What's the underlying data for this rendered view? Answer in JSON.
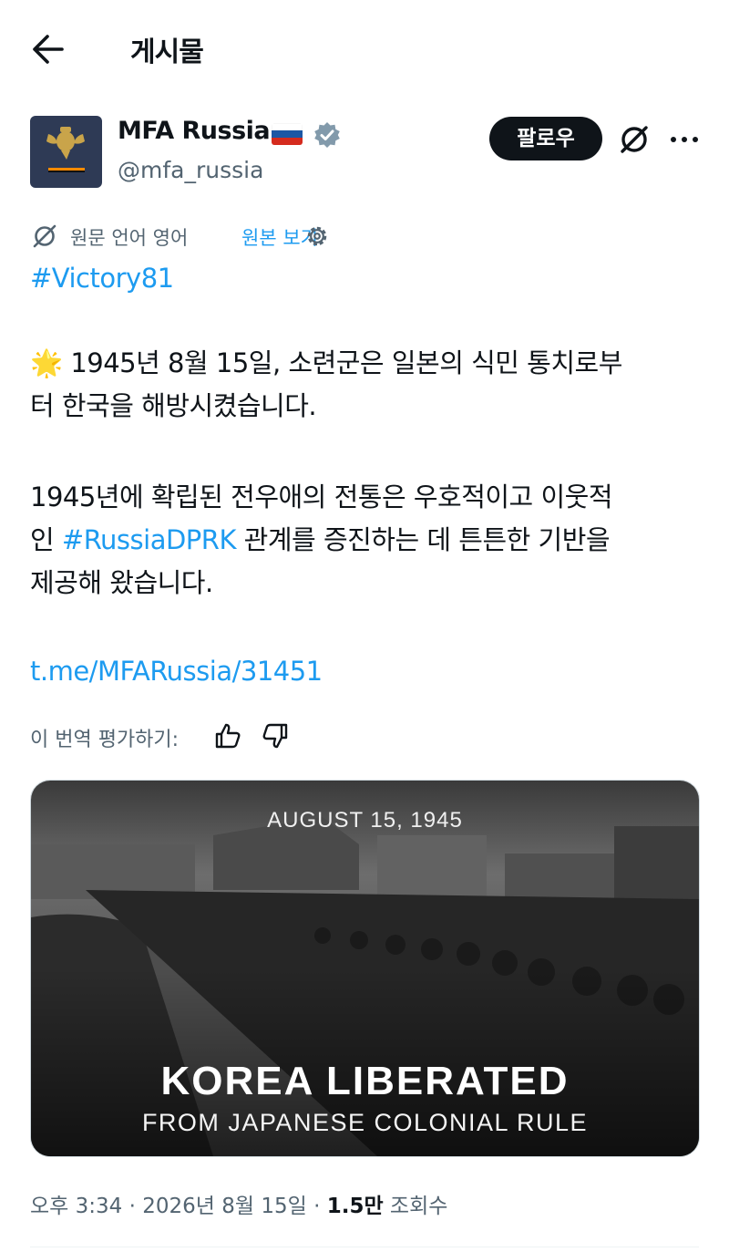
{
  "header": {
    "title": "게시물",
    "back_icon": "arrow-left-icon"
  },
  "author": {
    "name": "MFA Russia",
    "handle": "@mfa_russia",
    "flag": "russia-flag",
    "verified_color": "#829aab",
    "avatar_bg": "#2e3a55"
  },
  "actions": {
    "follow_label": "팔로우",
    "grok_icon": "grok-icon",
    "more_icon": "more-icon"
  },
  "translation": {
    "info": "원문 언어 영어",
    "show_original": "원본 보기",
    "settings_icon": "gear-icon"
  },
  "post": {
    "hashtag": "#Victory81",
    "sun_emoji": "🌟",
    "p1_line1": "1945년 8월 15일, 소련군은 일본의 식민 통치로부",
    "p1_line2": "터 한국을 해방시켰습니다.",
    "p2_line1": "1945년에 확립된 전우애의 전통은 우호적이고 이웃적",
    "p2_line2_pre": "인 ",
    "p2_hashtag": "#RussiaDPRK",
    "p2_line2_post": " 관계를 증진하는 데 튼튼한 기반을",
    "p2_line3": "제공해 왔습니다.",
    "link": "t.me/MFARussia/31451"
  },
  "rate": {
    "label": "이 번역 평가하기:"
  },
  "media": {
    "date": "AUGUST 15, 1945",
    "title": "KOREA LIBERATED",
    "subtitle": "FROM JAPANESE COLONIAL RULE"
  },
  "meta": {
    "time": "오후 3:34",
    "date": "2026년 8월 15일",
    "views_count": "1.5만",
    "views_label": "조회수"
  },
  "colors": {
    "accent": "#1d9bf0",
    "text": "#0f1419",
    "muted": "#536471"
  }
}
